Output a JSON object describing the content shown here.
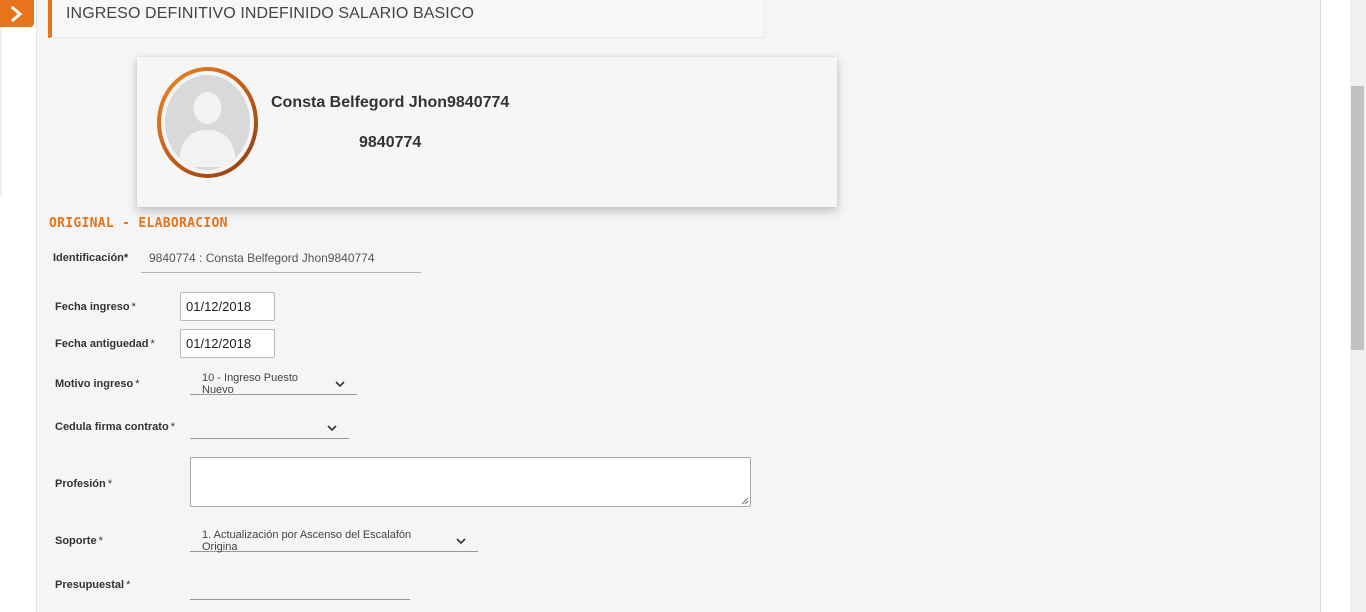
{
  "header": {
    "title": "INGRESO DEFINITIVO INDEFINIDO SALARIO BASICO"
  },
  "profile": {
    "name": "Consta Belfegord Jhon9840774",
    "id": "9840774"
  },
  "section": {
    "title": "ORIGINAL - ELABORACION"
  },
  "form": {
    "identificacion": {
      "label": "Identificación*",
      "value": "9840774 : Consta Belfegord  Jhon9840774"
    },
    "fecha_ingreso": {
      "label": "Fecha ingreso",
      "value": "01/12/2018"
    },
    "fecha_antiguedad": {
      "label": "Fecha antiguedad",
      "value": "01/12/2018"
    },
    "motivo_ingreso": {
      "label": "Motivo ingreso",
      "value": "10 - Ingreso Puesto Nuevo"
    },
    "cedula_firma": {
      "label": "Cedula firma contrato",
      "value": ""
    },
    "profesion": {
      "label": "Profesión",
      "value": ""
    },
    "soporte": {
      "label": "Soporte",
      "value": "1. Actualización por Ascenso del Escalafón Origina"
    },
    "presupuestal": {
      "label": "Presupuestal",
      "value": ""
    },
    "required_mark": "*"
  },
  "colors": {
    "accent": "#e8731a",
    "background": "#f5f5f5"
  },
  "icons": {
    "sidebar_toggle": "chevron-right-icon",
    "select": "chevron-down-icon",
    "avatar": "user-silhouette-icon"
  }
}
